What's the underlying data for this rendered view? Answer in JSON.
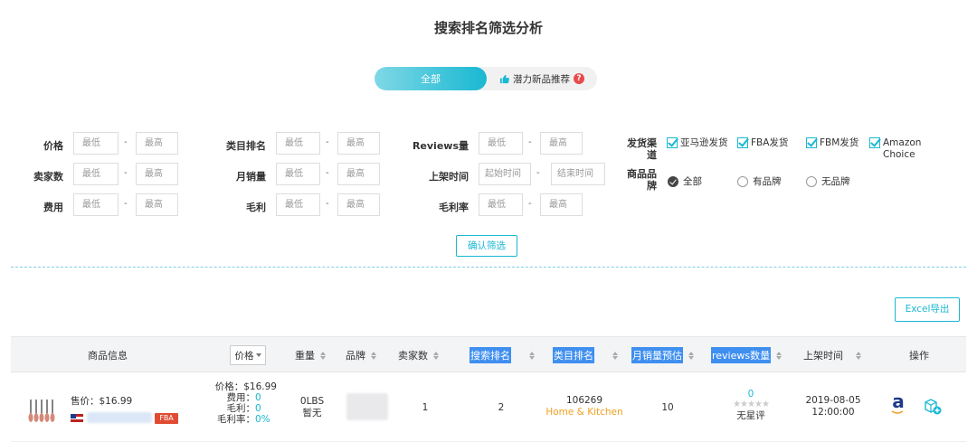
{
  "page": {
    "title": "搜索排名筛选分析"
  },
  "tabs": {
    "all": "全部",
    "potential": "潜力新品推荐",
    "help": "?"
  },
  "filters": {
    "price_label": "价格",
    "category_rank_label": "类目排名",
    "reviews_label": "Reviews量",
    "seller_count_label": "卖家数",
    "monthly_sales_label": "月销量",
    "listed_time_label": "上架时间",
    "fee_label": "费用",
    "profit_label": "毛利",
    "profit_rate_label": "毛利率",
    "min_placeholder": "最低",
    "max_placeholder": "最高",
    "start_time_placeholder": "起始时间",
    "end_time_placeholder": "结束时间",
    "dash": "-",
    "channel_label": "发货渠道",
    "channels": [
      "亚马逊发货",
      "FBA发货",
      "FBM发货",
      "Amazon Choice"
    ],
    "brand_label": "商品品牌",
    "brand_options": [
      "全部",
      "有品牌",
      "无品牌"
    ],
    "confirm": "确认筛选"
  },
  "excel_button": "Excel导出",
  "table": {
    "headers": {
      "product": "商品信息",
      "price": "价格",
      "weight": "重量",
      "brand": "品牌",
      "sellers": "卖家数",
      "search_rank": "搜索排名",
      "category_rank": "类目排名",
      "monthly_sales_est": "月销量预估",
      "reviews": "reviews数量",
      "listed_time": "上架时间",
      "actions": "操作"
    },
    "row": {
      "sale_price": "售价：$16.99",
      "fba": "FBA",
      "price_line": "价格：$16.99",
      "fee_label": "费用：",
      "fee_value": "0",
      "profit_label": "毛利：",
      "profit_value": "0",
      "profit_rate_label": "毛利率：",
      "profit_rate_value": "0%",
      "weight": "0LBS",
      "weight_note": "暂无",
      "sellers": "1",
      "search_rank": "2",
      "category_rank": "106269",
      "category_name": "Home & Kitchen",
      "monthly_sales": "10",
      "reviews_count": "0",
      "stars": "★★★★★",
      "no_rating": "无星评",
      "listed_date": "2019-08-05",
      "listed_clock": "12:00:00",
      "amazon_glyph": "a"
    }
  },
  "colors": {
    "accent": "#19b8d2",
    "highlight": "#3f8ff0",
    "orange": "#f0a020",
    "fba": "#e04b32"
  }
}
